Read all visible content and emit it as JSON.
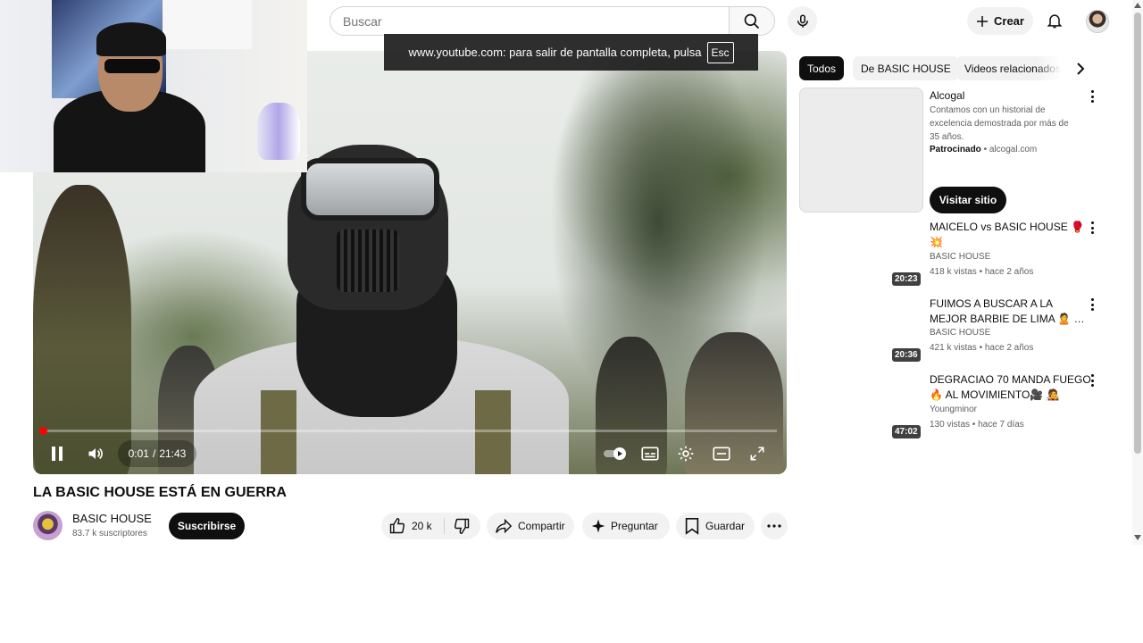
{
  "header": {
    "search_placeholder": "Buscar",
    "create_label": "Crear",
    "icons": [
      "search-icon",
      "mic-icon",
      "plus-icon",
      "bell-icon",
      "avatar"
    ]
  },
  "fullscreen_toast": {
    "text": "www.youtube.com: para salir de pantalla completa, pulsa",
    "key": "Esc"
  },
  "player": {
    "current_time": "0:01",
    "separator": "/",
    "duration": "21:43",
    "progress": 0.001,
    "controls": [
      "pause-icon",
      "volume-icon",
      "autoplay-toggle",
      "subtitles-icon",
      "settings-icon",
      "theater-icon",
      "fullscreen-exit-icon"
    ]
  },
  "video": {
    "title": "LA BASIC HOUSE ESTÁ EN GUERRA",
    "channel_name": "BASIC HOUSE",
    "subscribers": "83.7 k suscriptores",
    "subscribe_label": "Suscribirse",
    "likes": "20 k",
    "share_label": "Compartir",
    "ask_label": "Preguntar",
    "save_label": "Guardar"
  },
  "chips": [
    "Todos",
    "De BASIC HOUSE",
    "Videos relacionados"
  ],
  "ad": {
    "title": "Alcogal",
    "description": "Contamos con un historial de excelencia demostrada por más de 35 años.",
    "sponsored": "Patrocinado",
    "dot": "•",
    "domain": "alcogal.com",
    "cta": "Visitar sitio"
  },
  "recommendations": [
    {
      "title_line1": "MAICELO vs BASIC HOUSE 🥊",
      "title_line2": "💥",
      "channel": "BASIC HOUSE",
      "views": "418 k vistas",
      "age": "hace 2 años",
      "duration": "20:23"
    },
    {
      "title_line1": "FUIMOS A BUSCAR A LA",
      "title_line2": "MEJOR BARBIE DE LIMA 🙎 …",
      "channel": "BASIC HOUSE",
      "views": "421 k vistas",
      "age": "hace 2 años",
      "duration": "20:36"
    },
    {
      "title_line1": "DEGRACIAO 70 MANDA FUEGO",
      "title_line2": "🔥 AL MOVIMIENTO🎥 🧑‍🎤",
      "channel": "Youngminor",
      "views": "130 vistas",
      "age": "hace 7 días",
      "duration": "47:02"
    }
  ],
  "colors": {
    "accent": "#ff0000",
    "text": "#0f0f0f",
    "secondary": "#606060",
    "chip_bg": "#f2f2f2"
  }
}
